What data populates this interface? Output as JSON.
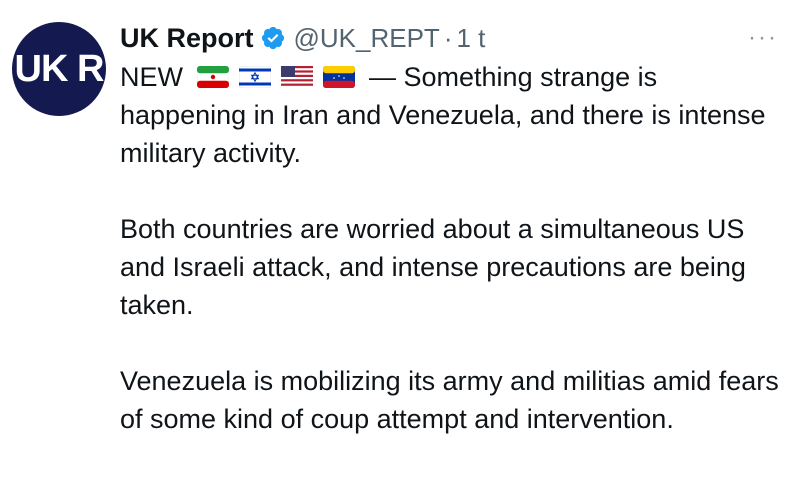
{
  "tweet": {
    "author_name": "UK Report",
    "handle": "@UK_REPT",
    "separator": "·",
    "time": "1 t",
    "more_label": "···",
    "avatar_text": "UK R",
    "lead": "NEW",
    "flags": [
      "iran-flag",
      "israel-flag",
      "us-flag",
      "venezuela-flag"
    ],
    "dash_text": "— Something strange is",
    "para1_rest": "happening in Iran and Venezuela, and there is intense military activity.",
    "para2": "Both countries are worried about a simultaneous US and Israeli attack, and intense precautions are being taken.",
    "para3": "Venezuela is mobilizing its army and militias amid fears of some kind of coup attempt and intervention."
  },
  "colors": {
    "avatar_bg": "#14194f",
    "verified_blue": "#1d9bf0",
    "secondary_text": "#536471"
  }
}
